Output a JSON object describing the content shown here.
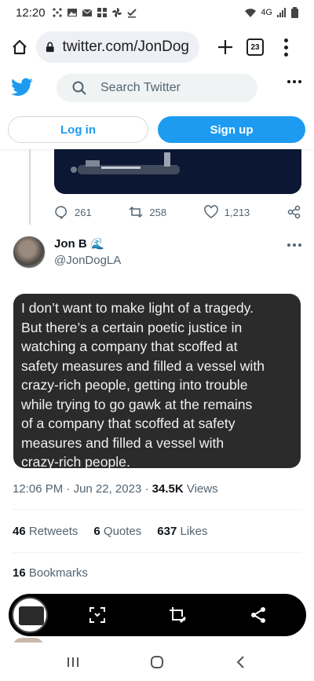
{
  "status_bar": {
    "time": "12:20",
    "network": "4G"
  },
  "browser": {
    "url": "twitter.com/JonDogLA",
    "tab_count": "23"
  },
  "twitter_header": {
    "search_placeholder": "Search Twitter"
  },
  "auth": {
    "login_label": "Log in",
    "signup_label": "Sign up"
  },
  "prev_tweet_actions": {
    "replies": "261",
    "retweets": "258",
    "likes": "1,213"
  },
  "author": {
    "name": "Jon B",
    "name_emoji": "🌊",
    "handle": "@JonDogLA"
  },
  "tweet": {
    "lines": [
      "I don’t want to make light of a tragedy.",
      "But there’s a certain poetic justice in",
      "watching a company that scoffed at",
      "safety measures and filled a vessel with",
      "crazy-rich people, getting into trouble",
      "while trying to go gawk at the remains",
      "of a company that scoffed at safety",
      "measures and filled a vessel with",
      "crazy-rich people."
    ],
    "time": "12:06 PM",
    "date": "Jun 22, 2023",
    "views_count": "34.5K",
    "views_label": "Views"
  },
  "stats": {
    "retweets_count": "46",
    "retweets_label": "Retweets",
    "quotes_count": "6",
    "quotes_label": "Quotes",
    "likes_count": "637",
    "likes_label": "Likes",
    "bookmarks_count": "16",
    "bookmarks_label": "Bookmarks"
  },
  "colors": {
    "twitter_blue": "#1d9bf0",
    "tweet_box_bg": "#2b2b2b",
    "secondary_text": "#536471"
  }
}
